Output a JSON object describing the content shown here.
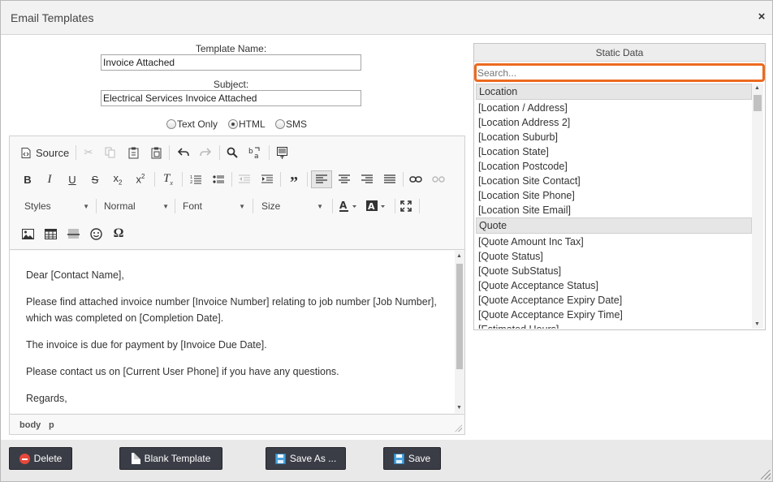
{
  "dialog": {
    "title": "Email Templates",
    "close_icon": "×"
  },
  "form": {
    "template_name_label": "Template Name:",
    "template_name_value": "Invoice Attached",
    "subject_label": "Subject:",
    "subject_value": "Electrical Services Invoice Attached",
    "format_options": [
      {
        "label": "Text Only",
        "selected": false
      },
      {
        "label": "HTML",
        "selected": true
      },
      {
        "label": "SMS",
        "selected": false
      }
    ]
  },
  "editor": {
    "toolbar": {
      "source_label": "Source",
      "styles_label": "Styles",
      "format_label": "Normal",
      "font_label": "Font",
      "size_label": "Size",
      "icons": [
        "source-icon",
        "cut-icon",
        "copy-icon",
        "paste-icon",
        "paste-text-icon",
        "undo-icon",
        "redo-icon",
        "find-icon",
        "replace-icon",
        "template-icon",
        "bold-icon",
        "italic-icon",
        "underline-icon",
        "strikethrough-icon",
        "subscript-icon",
        "superscript-icon",
        "remove-format-icon",
        "numbered-list-icon",
        "bulleted-list-icon",
        "outdent-icon",
        "indent-icon",
        "blockquote-icon",
        "align-left-icon",
        "align-center-icon",
        "align-right-icon",
        "justify-icon",
        "link-icon",
        "unlink-icon",
        "text-color-icon",
        "background-color-icon",
        "maximize-icon",
        "image-icon",
        "table-icon",
        "horizontal-line-icon",
        "smiley-icon",
        "special-char-icon"
      ]
    },
    "content": {
      "paragraphs": [
        "Dear [Contact Name],",
        "Please find attached invoice number [Invoice Number] relating to job number [Job Number], which was completed on [Completion Date].",
        "The invoice is due for payment by [Invoice Due Date].",
        "Please contact us on [Current User Phone] if you have any questions.",
        "Regards,"
      ]
    },
    "path": [
      "body",
      "p"
    ]
  },
  "static_data": {
    "title": "Static Data",
    "search_placeholder": "Search...",
    "groups": [
      {
        "name": "Location",
        "items": [
          "[Location / Address]",
          "[Location Address 2]",
          "[Location Suburb]",
          "[Location State]",
          "[Location Postcode]",
          "[Location Site Contact]",
          "[Location Site Phone]",
          "[Location Site Email]"
        ]
      },
      {
        "name": "Quote",
        "items": [
          "[Quote Amount Inc Tax]",
          "[Quote Status]",
          "[Quote SubStatus]",
          "[Quote Acceptance Status]",
          "[Quote Acceptance Expiry Date]",
          "[Quote Acceptance Expiry Time]",
          "[Estimated Hours]"
        ]
      }
    ]
  },
  "footer": {
    "delete_label": "Delete",
    "blank_template_label": "Blank Template",
    "save_as_label": "Save As ...",
    "save_label": "Save"
  },
  "colors": {
    "accent_focus": "#ec6a1f",
    "button_bg": "#3a3d46",
    "delete_icon": "#e6483c",
    "save_icon": "#4aa3df"
  }
}
